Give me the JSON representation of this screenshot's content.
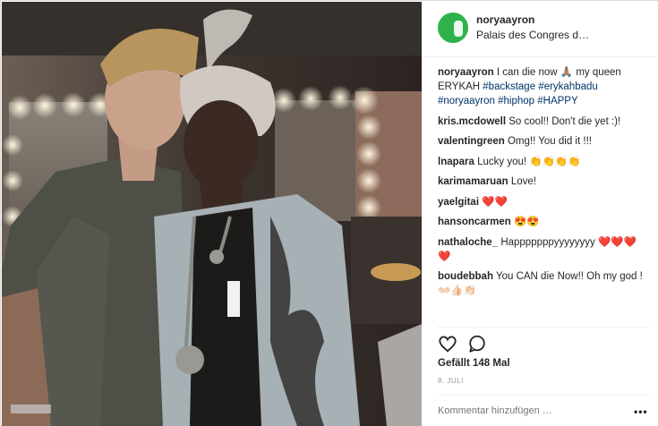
{
  "post": {
    "username": "noryaayron",
    "location": "Palais des Congres d…",
    "caption": {
      "user": "noryaayron",
      "text": "I can die now 🙏🏽 my queen ERYKAH ",
      "tags": "#backstage #erykahbadu #noryaayron #hiphop #HAPPY"
    },
    "comments": [
      {
        "user": "kris.mcdowell",
        "text": "So cool!! Don't die yet :)!"
      },
      {
        "user": "valentingreen",
        "text": "Omg!! You did it !!!"
      },
      {
        "user": "lnapara",
        "text": "Lucky you! 👏👏👏👏"
      },
      {
        "user": "karimamaruan",
        "text": "Love!"
      },
      {
        "user": "yaelgitai",
        "text": "❤️❤️"
      },
      {
        "user": "hansoncarmen",
        "text": "😍😍"
      },
      {
        "user": "nathaloche_",
        "text": "Happpppppyyyyyyyy ❤️❤️❤️❤️"
      },
      {
        "user": "boudebbah",
        "text": "You CAN die Now!! Oh my god ! 👐🏻👍🏻👏🏻"
      }
    ],
    "likes": "Gefällt 148 Mal",
    "date": "8. JULI",
    "comment_placeholder": "Kommentar hinzufügen …",
    "more_label": "•••",
    "icons": {
      "like": "heart-icon",
      "comment": "speech-bubble-icon",
      "more": "more-options-icon"
    },
    "colors": {
      "avatar_bg": "#2fb24a",
      "tag": "#003569",
      "muted": "#999999"
    }
  }
}
